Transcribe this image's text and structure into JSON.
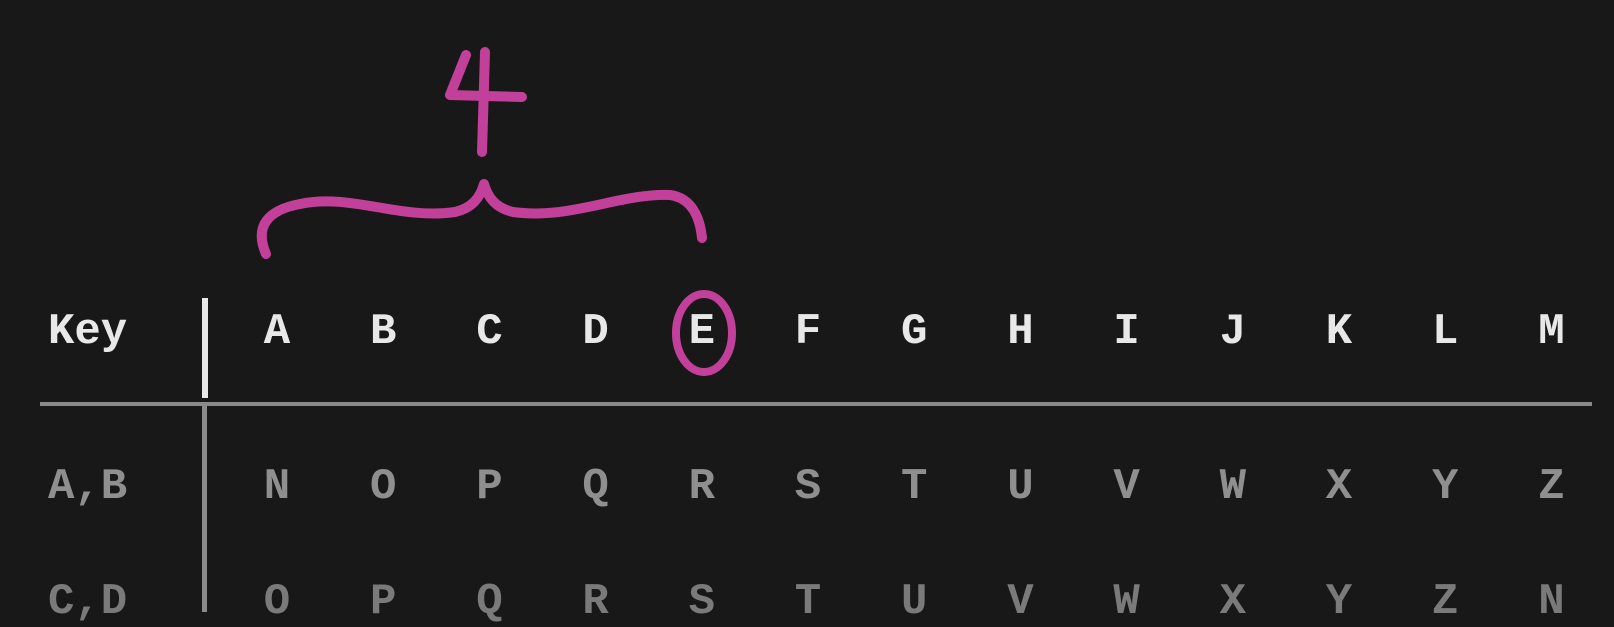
{
  "table": {
    "header_label": "Key",
    "columns": [
      "A",
      "B",
      "C",
      "D",
      "E",
      "F",
      "G",
      "H",
      "I",
      "J",
      "K",
      "L",
      "M"
    ],
    "rows": [
      {
        "key": "A,B",
        "cells": [
          "N",
          "O",
          "P",
          "Q",
          "R",
          "S",
          "T",
          "U",
          "V",
          "W",
          "X",
          "Y",
          "Z"
        ]
      },
      {
        "key": "C,D",
        "cells": [
          "O",
          "P",
          "Q",
          "R",
          "S",
          "T",
          "U",
          "V",
          "W",
          "X",
          "Y",
          "Z",
          "N"
        ]
      }
    ]
  },
  "annotation": {
    "number": "4",
    "color": "#c2409a",
    "circled_letter": "E"
  }
}
